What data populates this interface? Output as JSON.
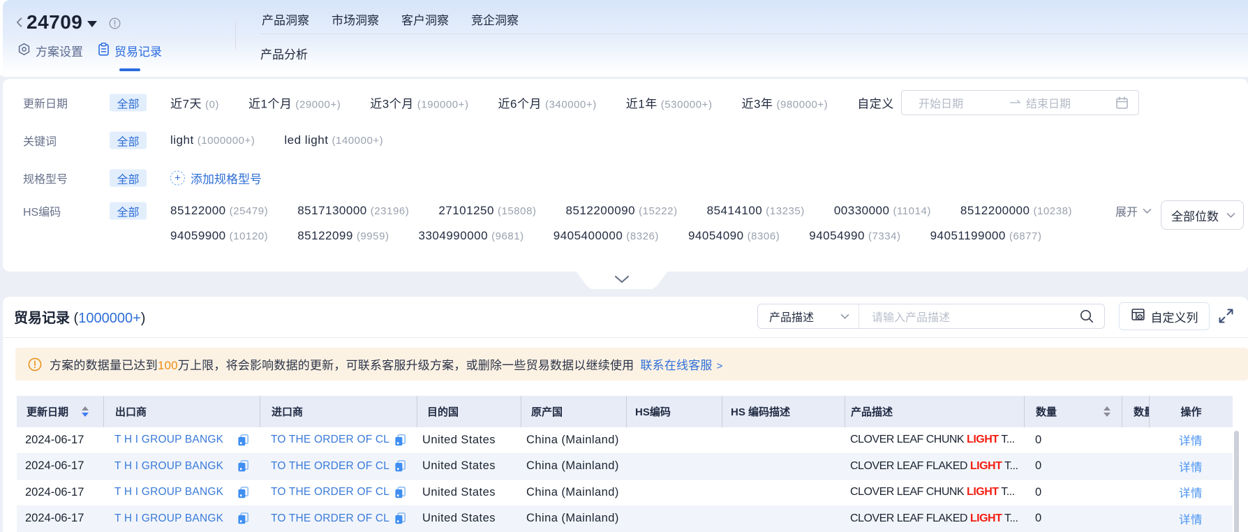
{
  "colors": {
    "accent_blue": "#2a6ce0",
    "link_blue": "#3a7ad9",
    "action_blue": "#4b94f2",
    "chip_bg": "#e2eefc",
    "warning_orange": "#ee8d18",
    "notice_bg": "#fcf2e4",
    "highlight_red": "#f41e12",
    "table_header_bg": "#e8ecf7",
    "stripe_row_bg": "#f1f5fb",
    "page_bg": "#edeff7"
  },
  "icons": {
    "back-icon": "chevron-left",
    "plan-caret-icon": "caret-down",
    "info-icon": "circle-exclamation",
    "gear-icon": "hexagon-nut",
    "clipboard-icon": "clipboard",
    "plus-circle-icon": "+",
    "calendar-icon": "calendar",
    "range-arrow-icon": "arrow-right",
    "chevron-down-icon": "chevron-down",
    "search-icon": "magnifier",
    "custom-columns-icon": "table-gear",
    "fullscreen-icon": "expand-arrows",
    "warning-icon": "circle-exclamation",
    "copy-icon": "copy",
    "sort-icon": "caret-pair"
  },
  "header": {
    "plan_id": "24709",
    "tabs": [
      {
        "label": "方案设置"
      },
      {
        "label": "贸易记录"
      }
    ],
    "nav": [
      {
        "label": "产品洞察"
      },
      {
        "label": "市场洞察"
      },
      {
        "label": "客户洞察"
      },
      {
        "label": "竞企洞察"
      }
    ],
    "sub_nav": "产品分析"
  },
  "filters": {
    "all": "全部",
    "update_date": {
      "label": "更新日期",
      "options": [
        {
          "label": "近7天",
          "count": "(0)"
        },
        {
          "label": "近1个月",
          "count": "(29000+)"
        },
        {
          "label": "近3个月",
          "count": "(190000+)"
        },
        {
          "label": "近6个月",
          "count": "(340000+)"
        },
        {
          "label": "近1年",
          "count": "(530000+)"
        },
        {
          "label": "近3年",
          "count": "(980000+)"
        },
        {
          "label": "自定义",
          "count": ""
        }
      ],
      "start_placeholder": "开始日期",
      "end_placeholder": "结束日期"
    },
    "keyword": {
      "label": "关键词",
      "options": [
        {
          "label": "light",
          "count": "(1000000+)"
        },
        {
          "label": "led light",
          "count": "(140000+)"
        }
      ]
    },
    "spec": {
      "label": "规格型号",
      "add_label": "添加规格型号"
    },
    "hs_code": {
      "label": "HS编码",
      "line1": [
        {
          "label": "85122000",
          "count": "(25479)"
        },
        {
          "label": "8517130000",
          "count": "(23196)"
        },
        {
          "label": "27101250",
          "count": "(15808)"
        },
        {
          "label": "8512200090",
          "count": "(15222)"
        },
        {
          "label": "85414100",
          "count": "(13235)"
        },
        {
          "label": "00330000",
          "count": "(11014)"
        },
        {
          "label": "8512200000",
          "count": "(10238)"
        }
      ],
      "line2": [
        {
          "label": "94059900",
          "count": "(10120)"
        },
        {
          "label": "85122099",
          "count": "(9959)"
        },
        {
          "label": "3304990000",
          "count": "(9681)"
        },
        {
          "label": "9405400000",
          "count": "(8326)"
        },
        {
          "label": "94054090",
          "count": "(8306)"
        },
        {
          "label": "94054990",
          "count": "(7334)"
        },
        {
          "label": "94051199000",
          "count": "(6877)"
        }
      ],
      "expand_label": "展开",
      "digits_select": "全部位数"
    }
  },
  "records": {
    "title": "贸易记录",
    "count_open": " (",
    "count_value": "1000000+",
    "count_close": ")",
    "field_select": "产品描述",
    "search_placeholder": "请输入产品描述",
    "custom_columns_label": "自定义列",
    "notice": {
      "pre": "方案的数据量已达到",
      "num": "100",
      "post": "万上限，将会影响数据的更新，可联系客服升级方案，或删除一些贸易数据以继续使用",
      "link": "联系在线客服",
      "arrow": ">"
    },
    "table": {
      "col_date": "更新日期",
      "col_exporter": "出口商",
      "col_importer": "进口商",
      "col_dest": "目的国",
      "col_origin": "原产国",
      "col_hs": "HS编码",
      "col_hs_desc": "HS 编码描述",
      "col_product": "产品描述",
      "col_qty": "数量",
      "col_qty2": "数量",
      "col_action": "操作",
      "rows": [
        {
          "date": "2024-06-17",
          "exporter": "T H I GROUP BANGK",
          "importer": "TO THE ORDER OF CL",
          "dest": "United States",
          "origin": "China (Mainland)",
          "hs": "",
          "hs_desc": "",
          "product_pre": "CLOVER LEAF CHUNK ",
          "product_hl": "LIGHT",
          "product_post": " T...",
          "qty": "0",
          "action": "详情"
        },
        {
          "date": "2024-06-17",
          "exporter": "T H I GROUP BANGK",
          "importer": "TO THE ORDER OF CL",
          "dest": "United States",
          "origin": "China (Mainland)",
          "hs": "",
          "hs_desc": "",
          "product_pre": "CLOVER LEAF FLAKED ",
          "product_hl": "LIGHT",
          "product_post": " T...",
          "qty": "0",
          "action": "详情"
        },
        {
          "date": "2024-06-17",
          "exporter": "T H I GROUP BANGK",
          "importer": "TO THE ORDER OF CL",
          "dest": "United States",
          "origin": "China (Mainland)",
          "hs": "",
          "hs_desc": "",
          "product_pre": "CLOVER LEAF CHUNK ",
          "product_hl": "LIGHT",
          "product_post": " T...",
          "qty": "0",
          "action": "详情"
        },
        {
          "date": "2024-06-17",
          "exporter": "T H I GROUP BANGK",
          "importer": "TO THE ORDER OF CL",
          "dest": "United States",
          "origin": "China (Mainland)",
          "hs": "",
          "hs_desc": "",
          "product_pre": "CLOVER LEAF FLAKED ",
          "product_hl": "LIGHT",
          "product_post": " T...",
          "qty": "0",
          "action": "详情"
        }
      ]
    }
  }
}
